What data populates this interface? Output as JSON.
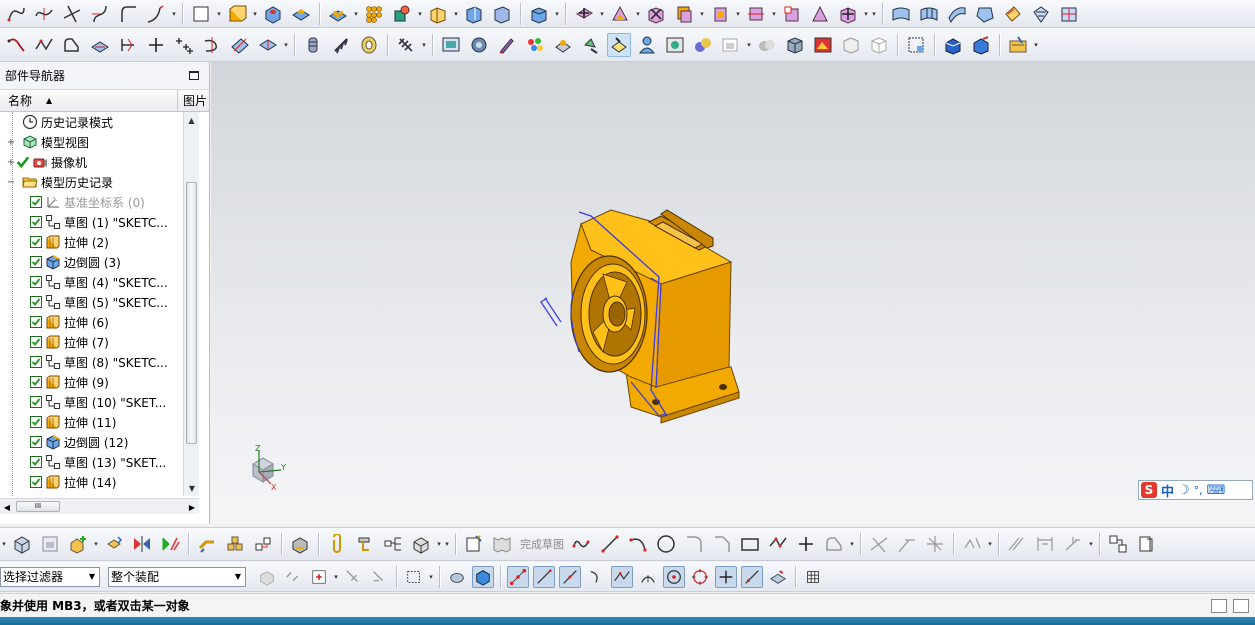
{
  "navigator": {
    "title": "部件导航器",
    "col_name": "名称",
    "col_img": "图片",
    "items": [
      {
        "label": "历史记录模式",
        "icon": "clock-icon",
        "expander": "",
        "check": false,
        "dim": false,
        "level": 0
      },
      {
        "label": "模型视图",
        "icon": "model-view-icon",
        "expander": "+",
        "check": false,
        "dim": false,
        "level": 0
      },
      {
        "label": "摄像机",
        "icon": "camera-icon",
        "expander": "+",
        "check": true,
        "dim": false,
        "level": 0
      },
      {
        "label": "模型历史记录",
        "icon": "folder-open-icon",
        "expander": "−",
        "check": false,
        "dim": false,
        "level": 0
      },
      {
        "label": "基准坐标系 (0)",
        "icon": "datum-csys-icon",
        "check": true,
        "dim": true,
        "level": 1
      },
      {
        "label": "草图 (1) \"SKETC...",
        "icon": "sketch-icon",
        "check": true,
        "dim": false,
        "level": 1
      },
      {
        "label": "拉伸 (2)",
        "icon": "extrude-icon",
        "check": true,
        "dim": false,
        "level": 1
      },
      {
        "label": "边倒圆 (3)",
        "icon": "edge-blend-icon",
        "check": true,
        "dim": false,
        "level": 1
      },
      {
        "label": "草图 (4) \"SKETC...",
        "icon": "sketch-icon",
        "check": true,
        "dim": false,
        "level": 1
      },
      {
        "label": "草图 (5) \"SKETC...",
        "icon": "sketch-icon",
        "check": true,
        "dim": false,
        "level": 1
      },
      {
        "label": "拉伸 (6)",
        "icon": "extrude-icon",
        "check": true,
        "dim": false,
        "level": 1
      },
      {
        "label": "拉伸 (7)",
        "icon": "extrude-icon",
        "check": true,
        "dim": false,
        "level": 1
      },
      {
        "label": "草图 (8) \"SKETC...",
        "icon": "sketch-icon",
        "check": true,
        "dim": false,
        "level": 1
      },
      {
        "label": "拉伸 (9)",
        "icon": "extrude-icon",
        "check": true,
        "dim": false,
        "level": 1
      },
      {
        "label": "草图 (10) \"SKET...",
        "icon": "sketch-icon",
        "check": true,
        "dim": false,
        "level": 1
      },
      {
        "label": "拉伸 (11)",
        "icon": "extrude-icon",
        "check": true,
        "dim": false,
        "level": 1
      },
      {
        "label": "边倒圆 (12)",
        "icon": "edge-blend-icon",
        "check": true,
        "dim": false,
        "level": 1
      },
      {
        "label": "草图 (13) \"SKET...",
        "icon": "sketch-icon",
        "check": true,
        "dim": false,
        "level": 1
      },
      {
        "label": "拉伸 (14)",
        "icon": "extrude-icon",
        "check": true,
        "dim": false,
        "level": 1
      }
    ],
    "hscroll_grip": "III"
  },
  "triad": {
    "x": "X",
    "y": "Y",
    "z": "Z"
  },
  "ime": {
    "zh": "中",
    "moon": "☽",
    "punct": "°,",
    "kbd": "⌨"
  },
  "sketch_toolbar": {
    "finish_sketch": "完成草图"
  },
  "selection": {
    "filter": "选择过滤器",
    "scope": "整个装配"
  },
  "status": {
    "message": "象并使用 MB3，或者双击某一对象"
  },
  "colors": {
    "model": "#f2a900",
    "model_dark": "#c98600",
    "sketch_line": "#3a3ae6",
    "check_green": "#1a9a1a"
  }
}
